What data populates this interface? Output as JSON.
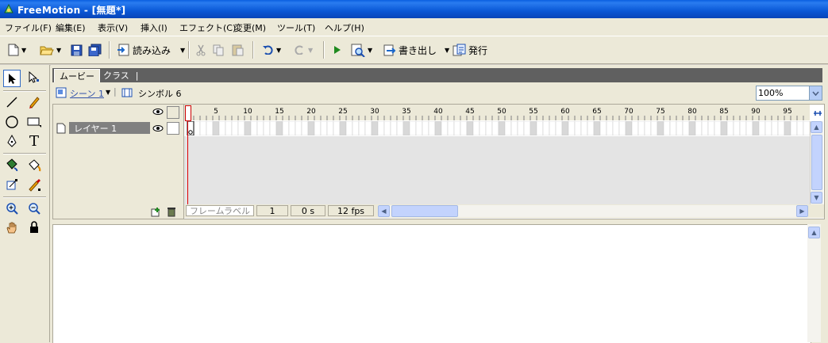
{
  "window": {
    "title": "FreeMotion - [無題*]"
  },
  "menu": [
    "ファイル(F)",
    "編集(E)",
    "表示(V)",
    "挿入(I)",
    "エフェクト(C)",
    "変更(M)",
    "ツール(T)",
    "ヘルプ(H)"
  ],
  "toolbar": {
    "import_label": "読み込み",
    "export_label": "書き出し",
    "publish_label": "発行"
  },
  "tabs": [
    "ムービー",
    "クラス"
  ],
  "breadcrumb": {
    "scene": "シーン 1",
    "symbol": "シンボル 6"
  },
  "zoom": "100%",
  "timeline": {
    "layer_name": "レイヤー 1",
    "ruler_ticks": [
      "5",
      "10",
      "15",
      "20",
      "25",
      "30",
      "35",
      "40",
      "45",
      "50",
      "55",
      "60",
      "65",
      "70",
      "75",
      "80",
      "85",
      "90",
      "95"
    ],
    "frame_label_placeholder": "フレームラベル",
    "current_frame": "1",
    "elapsed": "0 s",
    "fps": "12 fps"
  },
  "colors": {
    "titlebar": "#0a58d6",
    "playhead": "#e00000",
    "layer_selected": "#808080"
  }
}
